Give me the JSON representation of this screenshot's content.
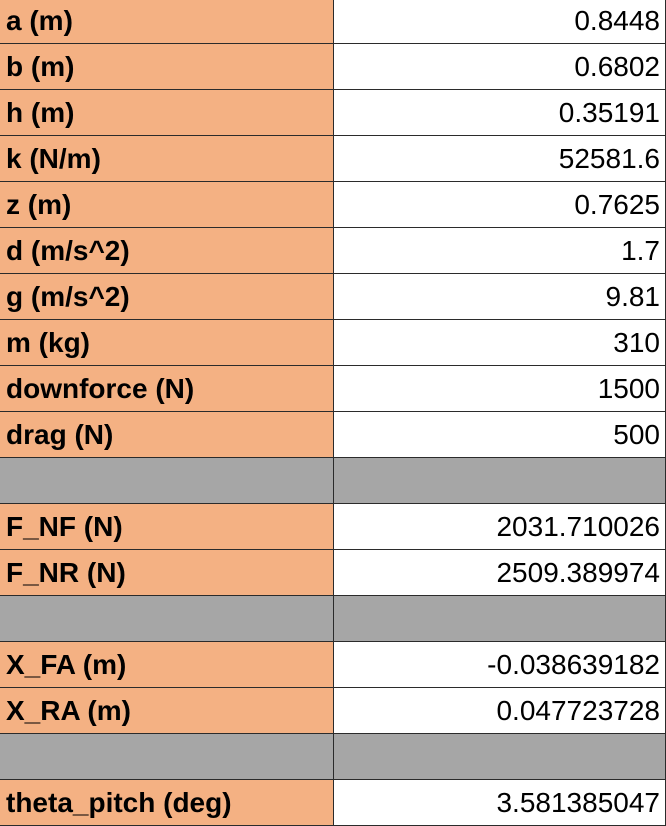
{
  "rows": [
    {
      "label": "a (m)",
      "value": "0.8448"
    },
    {
      "label": "b (m)",
      "value": "0.6802"
    },
    {
      "label": "h (m)",
      "value": "0.35191"
    },
    {
      "label": "k (N/m)",
      "value": "52581.6"
    },
    {
      "label": "z (m)",
      "value": "0.7625"
    },
    {
      "label": "d (m/s^2)",
      "value": "1.7"
    },
    {
      "label": "g (m/s^2)",
      "value": "9.81"
    },
    {
      "label": "m (kg)",
      "value": "310"
    },
    {
      "label": "downforce (N)",
      "value": "1500"
    },
    {
      "label": "drag (N)",
      "value": "500"
    },
    {
      "label": "",
      "value": ""
    },
    {
      "label": "F_NF (N)",
      "value": "2031.710026"
    },
    {
      "label": "F_NR (N)",
      "value": "2509.389974"
    },
    {
      "label": "",
      "value": ""
    },
    {
      "label": "X_FA (m)",
      "value": "-0.038639182"
    },
    {
      "label": "X_RA (m)",
      "value": "0.047723728"
    },
    {
      "label": "",
      "value": ""
    },
    {
      "label": "theta_pitch (deg)",
      "value": "3.581385047"
    }
  ],
  "colors": {
    "label_fill": "#f4b183",
    "value_fill": "#ffffff",
    "blank_fill": "#a6a6a6",
    "gridline": "#2b2b2b"
  }
}
